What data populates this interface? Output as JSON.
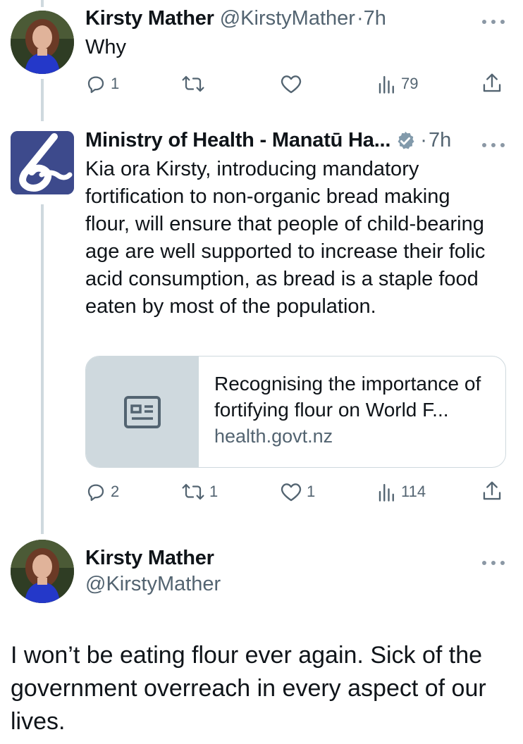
{
  "tweet1": {
    "name": "Kirsty Mather",
    "handle": "@KirstyMather",
    "sep": "·",
    "time": "7h",
    "text": "Why",
    "replies": "1",
    "views": "79"
  },
  "tweet2": {
    "name": "Ministry of Health - Manatū Ha...",
    "sep": "·",
    "time": "7h",
    "text": "Kia ora Kirsty, introducing mandatory fortification to non-organic bread making flour, will ensure that people of child-bearing age are well supported to increase their folic acid consumption, as bread is a staple food eaten by most of the population.",
    "card": {
      "title": "Recognising the importance of fortifying flour on World F...",
      "domain": "health.govt.nz"
    },
    "replies": "2",
    "reposts": "1",
    "likes": "1",
    "views": "114"
  },
  "tweet3": {
    "name": "Kirsty Mather",
    "handle": "@KirstyMather",
    "text": "I won’t be eating flour ever again. Sick of the government overreach in every aspect of our lives."
  },
  "colors": {
    "text": "#0f1419",
    "secondary": "#536471",
    "border": "#cfd9de",
    "verified": "#829aab",
    "ministry_logo": "#3d4a8c"
  }
}
